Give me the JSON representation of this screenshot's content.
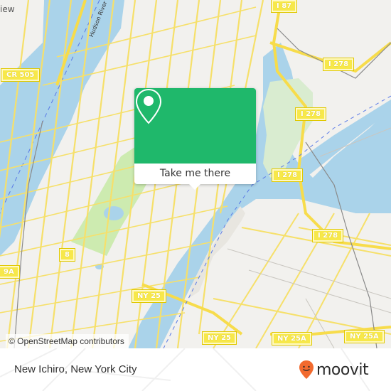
{
  "map": {
    "place_labels": [
      {
        "text": "iew"
      }
    ],
    "river_label": "Hudson River",
    "road_shields": [
      {
        "label": "I 87"
      },
      {
        "label": "CR 505"
      },
      {
        "label": "I 278"
      },
      {
        "label": "I 278"
      },
      {
        "label": "I 278"
      },
      {
        "label": "I 278"
      },
      {
        "label": "8"
      },
      {
        "label": "9A"
      },
      {
        "label": "NY 25"
      },
      {
        "label": "NY 25"
      },
      {
        "label": "NY 25A"
      },
      {
        "label": "NY 25A"
      }
    ],
    "attribution": "© OpenStreetMap contributors"
  },
  "popup": {
    "icon": "map-pin-icon",
    "cta_label": "Take me there",
    "accent_color": "#1fb86b"
  },
  "footer": {
    "title": "New Ichiro, New York City",
    "brand": {
      "name": "moovit",
      "icon": "moovit-smiley-pin-icon",
      "color": "#f26a2e"
    }
  }
}
